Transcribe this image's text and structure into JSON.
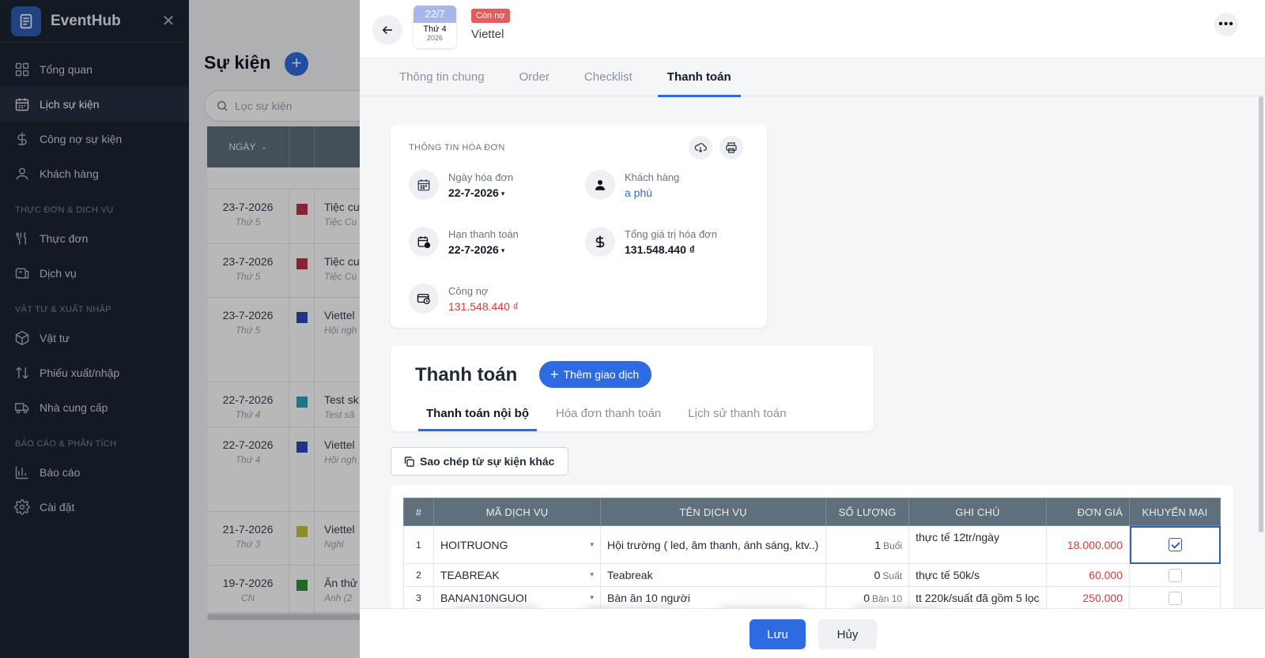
{
  "app": {
    "name": "EventHub"
  },
  "sidebar": {
    "items": [
      {
        "label": "Tổng quan"
      },
      {
        "label": "Lịch sự kiện"
      },
      {
        "label": "Công nợ sự kiện"
      },
      {
        "label": "Khách hàng"
      }
    ],
    "section_menu": "THỰC ĐƠN & DỊCH VỤ",
    "menu_items": [
      {
        "label": "Thực đơn"
      },
      {
        "label": "Dịch vụ"
      }
    ],
    "section_supply": "VẬT TƯ & XUẤT NHẬP",
    "supply_items": [
      {
        "label": "Vật tư"
      },
      {
        "label": "Phiếu xuất/nhập"
      },
      {
        "label": "Nhà cung cấp"
      }
    ],
    "section_report": "BÁO CÁO & PHÂN TÍCH",
    "report_items": [
      {
        "label": "Báo cáo"
      },
      {
        "label": "Cài đặt"
      }
    ]
  },
  "events_panel": {
    "title": "Sự kiện",
    "search_placeholder": "Lọc sự kiện",
    "column_date": "NGÀY",
    "rows": [
      {
        "date": "23-7-2026",
        "weekday": "Thứ 5",
        "color": "#c0304a",
        "name": "Tiệc cu",
        "sub": "Tiệc Cu"
      },
      {
        "date": "23-7-2026",
        "weekday": "Thứ 5",
        "color": "#c0304a",
        "name": "Tiệc cu",
        "sub": "Tiệc Cu"
      },
      {
        "date": "23-7-2026",
        "weekday": "Thứ 5",
        "color": "#2e48b8",
        "name": "Viettel",
        "sub": "Hội ngh"
      },
      {
        "date": "22-7-2026",
        "weekday": "Thứ 4",
        "color": "#2aa3b8",
        "name": "Test sk",
        "sub": "Test sâ"
      },
      {
        "date": "22-7-2026",
        "weekday": "Thứ 4",
        "color": "#2e48b8",
        "name": "Viettel",
        "sub": "Hội ngh"
      },
      {
        "date": "21-7-2026",
        "weekday": "Thứ 3",
        "color": "#bcc63a",
        "name": "Viettel",
        "sub": "Nghỉ"
      },
      {
        "date": "19-7-2026",
        "weekday": "CN",
        "color": "#2f8f3a",
        "name": "Ăn thử",
        "sub": "Anh (2"
      }
    ]
  },
  "drawer": {
    "date_day": "22/7",
    "date_weekday": "Thứ 4",
    "date_year": "2026",
    "status": "Còn nợ",
    "title": "Viettel",
    "tabs": [
      {
        "label": "Thông tin chung"
      },
      {
        "label": "Order"
      },
      {
        "label": "Checklist"
      },
      {
        "label": "Thanh toán"
      }
    ]
  },
  "invoice": {
    "section_title": "THÔNG TIN HÓA ĐƠN",
    "invoice_date_label": "Ngày hóa đơn",
    "invoice_date": "22-7-2026",
    "customer_label": "Khách hàng",
    "customer": "a phú",
    "due_date_label": "Hạn thanh toán",
    "due_date": "22-7-2026",
    "total_label": "Tổng giá trị hóa đơn",
    "total": "131.548.440 ₫",
    "debt_label": "Công nợ",
    "debt": "131.548.440 ₫"
  },
  "payment": {
    "title": "Thanh toán",
    "add_button": "Thêm giao dịch",
    "subtabs": [
      {
        "label": "Thanh toán nội bộ"
      },
      {
        "label": "Hóa đơn thanh toán"
      },
      {
        "label": "Lịch sử thanh toán"
      }
    ],
    "copy_button": "Sao chép từ sự kiện khác"
  },
  "services": {
    "headers": [
      "#",
      "MÃ DỊCH VỤ",
      "TÊN DỊCH VỤ",
      "SỐ LƯỢNG",
      "GHI CHÚ",
      "ĐƠN GIÁ",
      "KHUYẾN MẠI"
    ],
    "rows": [
      {
        "index": "1",
        "code": "HOITRUONG",
        "name": "Hội trường ( led, âm thanh, ánh sáng, ktv..)",
        "qty": "1",
        "unit": "Buổi",
        "note": "thực tế 12tr/ngày",
        "price": "18.000.000",
        "promo": true
      },
      {
        "index": "2",
        "code": "TEABREAK",
        "name": "Teabreak",
        "qty": "0",
        "unit": "Suất",
        "note": "thực tế 50k/s",
        "price": "60.000",
        "promo": false
      },
      {
        "index": "3",
        "code": "BANAN10NGUOI",
        "name": "Bàn ăn 10 người",
        "qty": "0",
        "unit": "Bàn 10",
        "note": "tt 220k/suất đã gồm 5 lọc",
        "price": "250.000",
        "promo": false
      }
    ]
  },
  "footer": {
    "save": "Lưu",
    "cancel": "Hủy"
  }
}
